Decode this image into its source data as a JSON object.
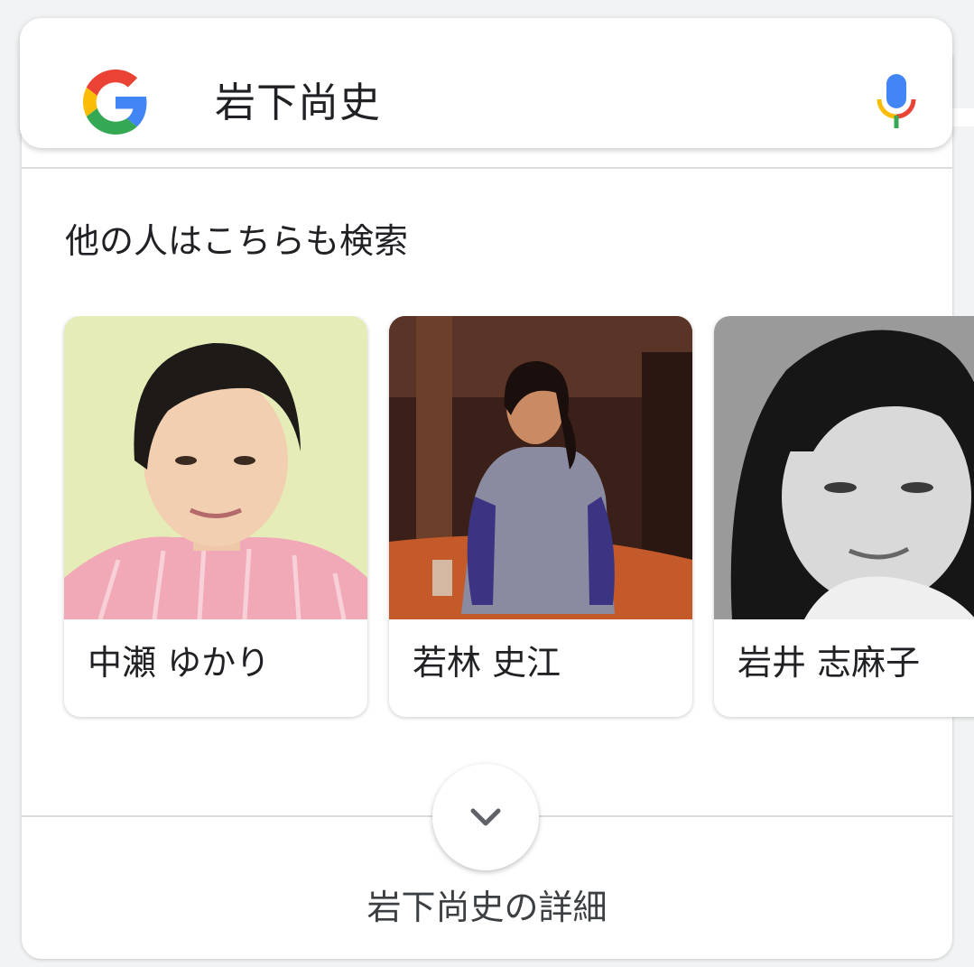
{
  "search": {
    "query": "岩下尚史",
    "logo_icon": "google-g-icon",
    "mic_icon": "microphone-icon"
  },
  "related": {
    "title": "他の人はこちらも検索",
    "people": [
      {
        "name": "中瀬 ゆかり"
      },
      {
        "name": "若林 史江"
      },
      {
        "name": "岩井 志麻子"
      }
    ]
  },
  "footer": {
    "expand_icon": "chevron-down-icon",
    "more_label": "岩下尚史の詳細"
  },
  "colors": {
    "google_blue": "#4285F4",
    "google_red": "#EA4335",
    "google_yellow": "#FBBC05",
    "google_green": "#34A853",
    "divider": "#dadce0"
  }
}
